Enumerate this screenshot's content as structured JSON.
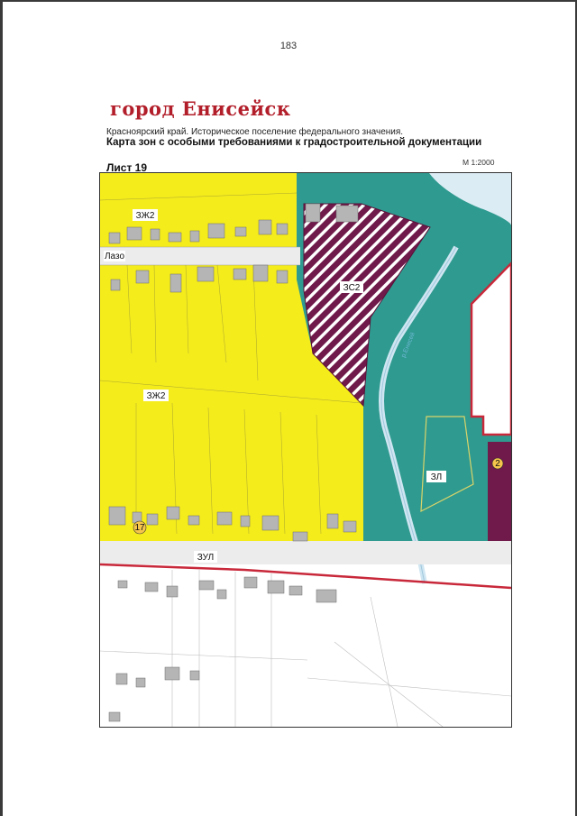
{
  "page_number": "183",
  "city_title": "город Енисейск",
  "subtitle": "Красноярский край. Историческое поселение федерального значения.",
  "map_title": "Карта зон с особыми требованиями к градостроительной документации",
  "sheet": "Лист 19",
  "scale": "М 1:2000",
  "street_lazo": "Лазо",
  "river_label": "р.Енисей",
  "zones": {
    "zh2_top": "ЗЖ2",
    "zh2_mid": "ЗЖ2",
    "zs2": "ЗС2",
    "zl": "ЗЛ",
    "zul": "ЗУЛ"
  },
  "markers": {
    "marker_17": "17",
    "marker_2": "2"
  },
  "colors": {
    "residential": "#f5ec1c",
    "green_zone": "#2f9a8f",
    "special_zone": "#6f1a4a",
    "water": "#dcecf5",
    "boundary": "#c8283a",
    "building": "#b5b5b5"
  }
}
